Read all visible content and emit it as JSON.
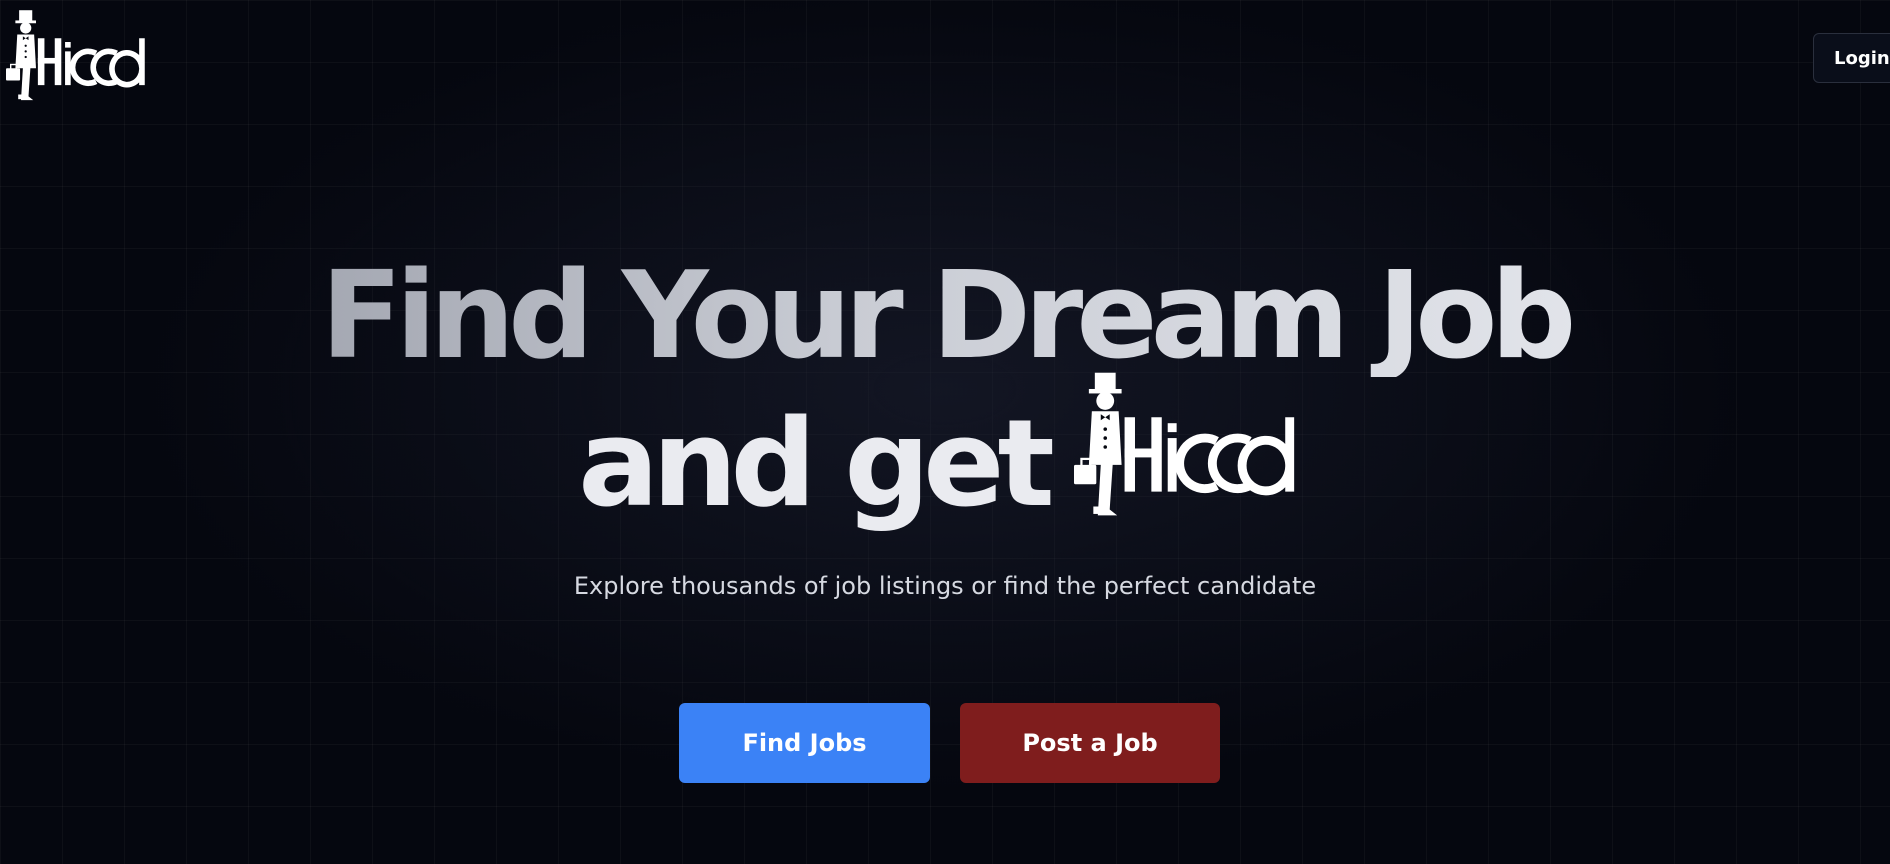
{
  "header": {
    "logo_icon": "hirrd-butler-logo",
    "login_label": "Login"
  },
  "hero": {
    "title_line_1": "Find Your Dream Job",
    "title_line_2": "and get",
    "title_logo_icon": "hirrd-butler-logo",
    "subtitle": "Explore thousands of job listings or find the perfect candidate"
  },
  "actions": {
    "find_jobs_label": "Find Jobs",
    "post_job_label": "Post a Job"
  },
  "colors": {
    "background": "#05070f",
    "find_jobs_button": "#3b82f6",
    "post_job_button": "#7f1d1d",
    "text": "#ffffff"
  }
}
